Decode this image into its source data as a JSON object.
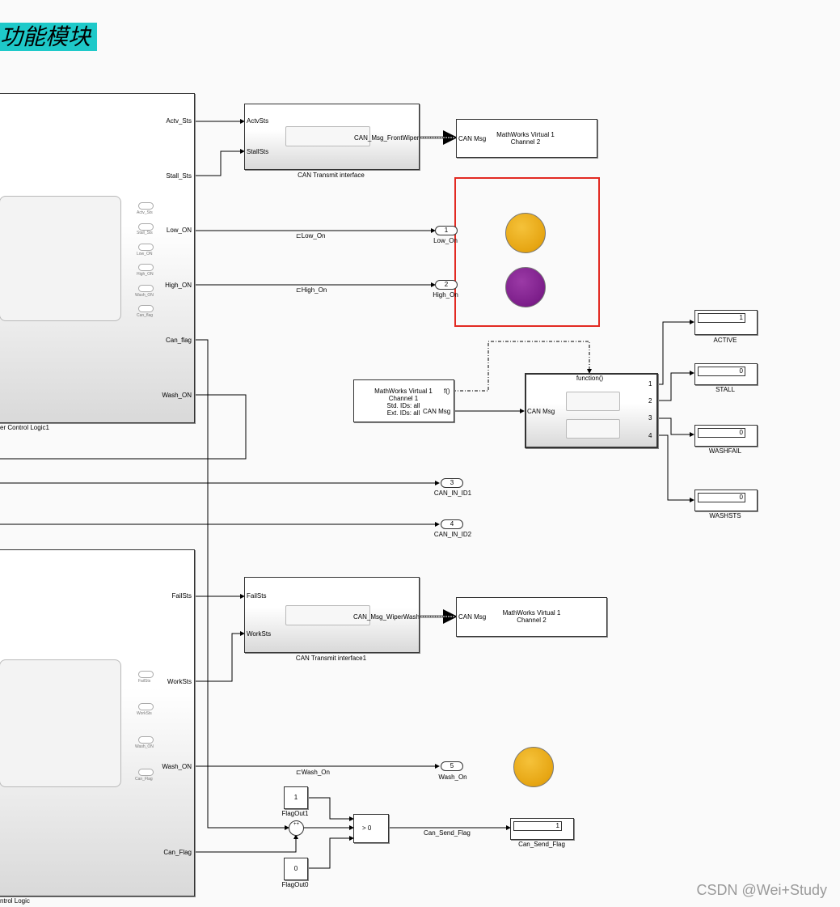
{
  "banner": {
    "title": "功能模块"
  },
  "subsystem1": {
    "caption": "er Control Logic1",
    "outputs": [
      "Actv_Sts",
      "Stall_Sts",
      "Low_ON",
      "High_ON",
      "Can_flag",
      "Wash_ON"
    ],
    "inner_ports": [
      "Actv_Sts",
      "Stall_Sts",
      "Low_ON",
      "High_ON",
      "Wash_ON",
      "Can_flag"
    ]
  },
  "subsystem2": {
    "caption": "ntrol Logic",
    "outputs": [
      "FailSts",
      "WorkSts",
      "Wash_ON",
      "Can_Flag"
    ],
    "inner_ports": [
      "FailSts",
      "WorkSts",
      "Wash_ON",
      "Can_Flag"
    ]
  },
  "can_tx1": {
    "caption": "CAN Transmit interface",
    "inputs": [
      "ActvSts",
      "StallSts"
    ],
    "output": "CAN_Msg_FrontWiper"
  },
  "can_tx2": {
    "caption": "CAN Transmit interface1",
    "inputs": [
      "FailSts",
      "WorkSts"
    ],
    "output": "CAN_Msg_WiperWash"
  },
  "virtual_tx1": {
    "port": "CAN Msg",
    "line1": "MathWorks Virtual 1",
    "line2": "Channel 2"
  },
  "virtual_tx2": {
    "port": "CAN Msg",
    "line1": "MathWorks Virtual 1",
    "line2": "Channel 2"
  },
  "virtual_rx": {
    "line1": "MathWorks Virtual 1",
    "line2": "Channel 1",
    "line3": "Std. IDs: all",
    "line4": "Ext. IDs: all",
    "port_f": "f()",
    "port_msg": "CAN Msg"
  },
  "func_subsys": {
    "title": "function()",
    "input": "CAN Msg",
    "outputs": [
      "1",
      "2",
      "3",
      "4"
    ]
  },
  "outports": [
    {
      "num": "1",
      "label": "Low_On"
    },
    {
      "num": "2",
      "label": "High_On"
    },
    {
      "num": "3",
      "label": "CAN_IN_ID1"
    },
    {
      "num": "4",
      "label": "CAN_IN_ID2"
    },
    {
      "num": "5",
      "label": "Wash_On"
    }
  ],
  "goto_tags": {
    "low": "Low_On",
    "high": "High_On",
    "wash": "Wash_On"
  },
  "displays": [
    {
      "label": "ACTIVE",
      "value": "1"
    },
    {
      "label": "STALL",
      "value": "0"
    },
    {
      "label": "WASHFAIL",
      "value": "0"
    },
    {
      "label": "WASHSTS",
      "value": "0"
    },
    {
      "label": "Can_Send_Flag",
      "value": "1"
    }
  ],
  "constants": [
    {
      "label": "FlagOut1",
      "value": "1"
    },
    {
      "label": "FlagOut0",
      "value": "0"
    }
  ],
  "switch": {
    "criteria": "> 0"
  },
  "sum": {
    "signs": "++"
  },
  "signal_can_send_flag": "Can_Send_Flag",
  "lamps": {
    "colors": [
      "#e6a512",
      "#7c1e8a",
      "#e6a512"
    ]
  },
  "watermark": "CSDN @Wei+Study"
}
